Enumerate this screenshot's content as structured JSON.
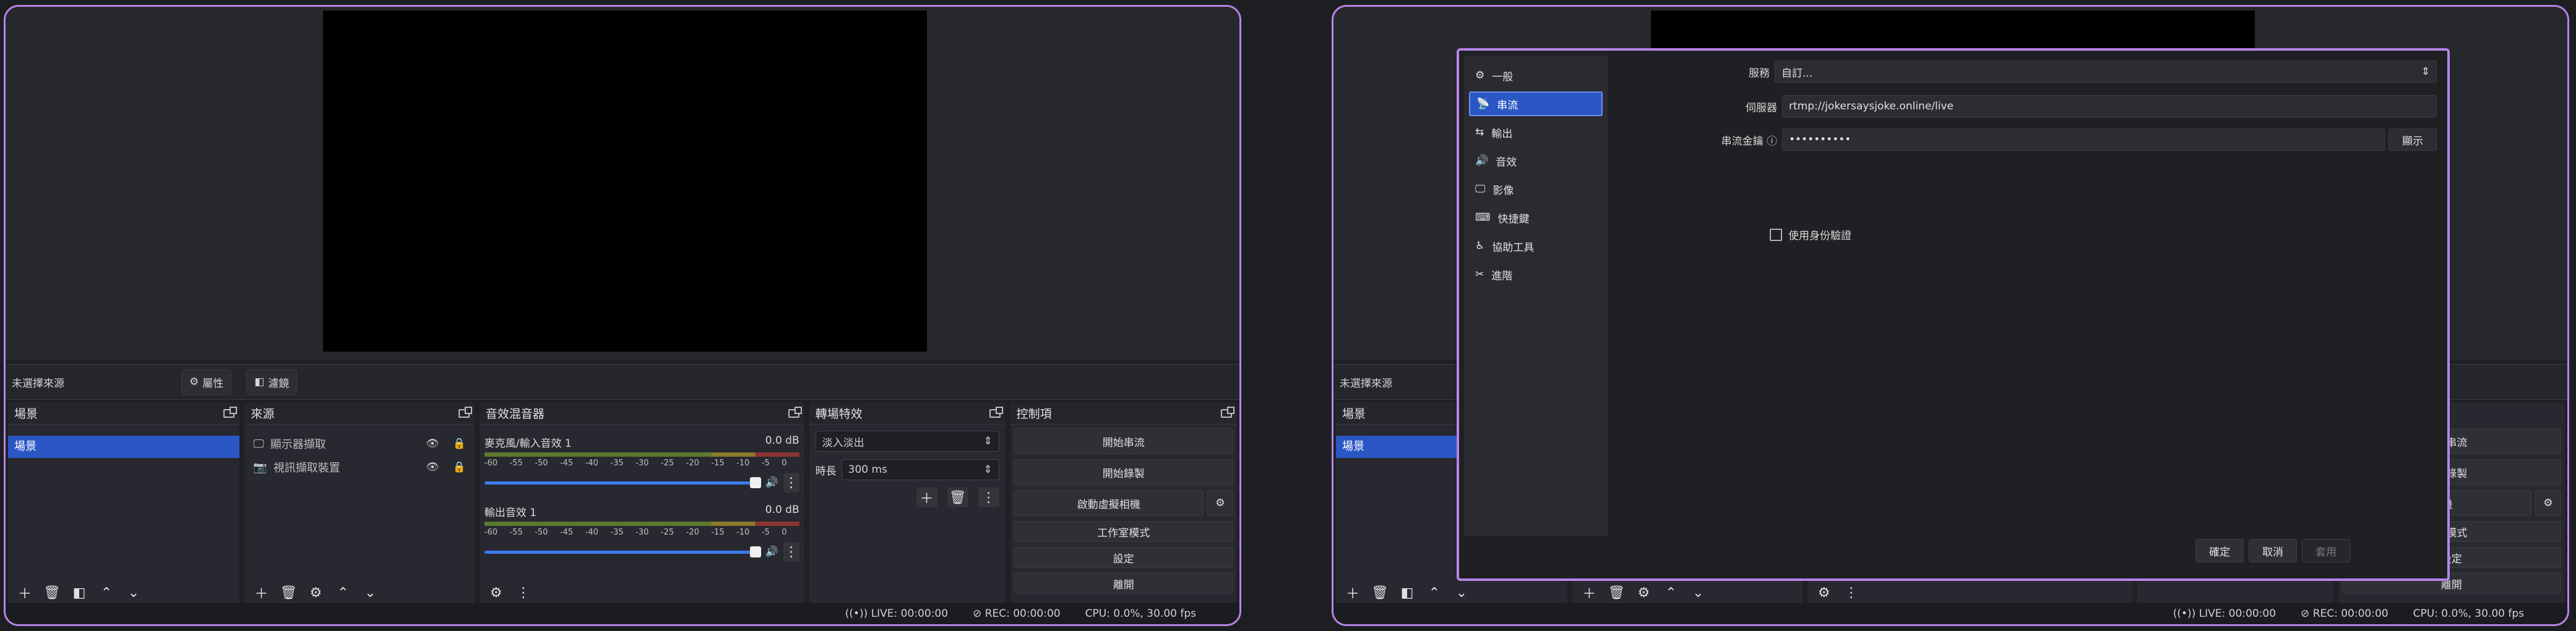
{
  "no_source": "未選擇來源",
  "props_label": "屬性",
  "filters_label": "濾鏡",
  "docks": {
    "scenes_title": "場景",
    "scene_item": "場景",
    "sources_title": "來源",
    "sources": [
      {
        "icon": "monitor-icon",
        "label": "顯示器擷取"
      },
      {
        "icon": "camera-icon",
        "label": "視訊擷取裝置"
      }
    ],
    "mixer_title": "音效混音器",
    "mixer": [
      {
        "name": "麥克風/輸入音效 1",
        "db": "0.0 dB"
      },
      {
        "name": "輸出音效 1",
        "db": "0.0 dB"
      }
    ],
    "meter_ticks": [
      "-60",
      "-55",
      "-50",
      "-45",
      "-40",
      "-35",
      "-30",
      "-25",
      "-20",
      "-15",
      "-10",
      "-5",
      "0"
    ],
    "transitions_title": "轉場特效",
    "transition": "淡入淡出",
    "duration_label": "時長",
    "duration": "300 ms",
    "controls_title": "控制項",
    "controls": [
      "開始串流",
      "開始錄製",
      "啟動虛擬相機",
      "工作室模式",
      "設定",
      "離開"
    ]
  },
  "status": {
    "live": "LIVE: 00:00:00",
    "rec": "REC: 00:00:00",
    "cpu": "CPU: 0.0%, 30.00 fps"
  },
  "right": {
    "controls_visible": [
      "始串流",
      "始錄製",
      "擬相機",
      "室模式",
      "設定",
      "離開"
    ]
  },
  "settings": {
    "nav": [
      {
        "icon": "gear-icon",
        "label": "一般"
      },
      {
        "icon": "antenna-icon",
        "label": "串流"
      },
      {
        "icon": "output-icon",
        "label": "輸出"
      },
      {
        "icon": "speaker-icon",
        "label": "音效"
      },
      {
        "icon": "monitor-icon",
        "label": "影像"
      },
      {
        "icon": "keyboard-icon",
        "label": "快捷鍵"
      },
      {
        "icon": "accessibility-icon",
        "label": "協助工具"
      },
      {
        "icon": "tools-icon",
        "label": "進階"
      }
    ],
    "service_label": "服務",
    "service_value": "自訂...",
    "server_label": "伺服器",
    "server_value": "rtmp://jokersaysjoke.online/live",
    "key_label": "串流金鑰",
    "key_value": "••••••••••",
    "show_label": "顯示",
    "auth_label": "使用身份驗證",
    "ok": "確定",
    "cancel": "取消",
    "apply": "套用"
  }
}
